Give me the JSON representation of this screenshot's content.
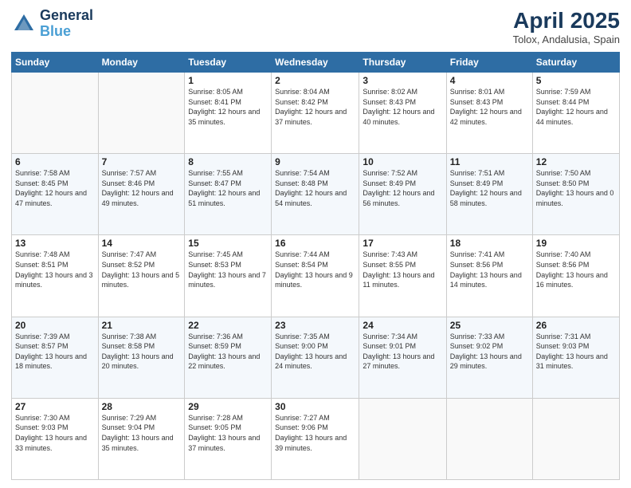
{
  "header": {
    "logo_line1": "General",
    "logo_line2": "Blue",
    "main_title": "April 2025",
    "subtitle": "Tolox, Andalusia, Spain"
  },
  "columns": [
    "Sunday",
    "Monday",
    "Tuesday",
    "Wednesday",
    "Thursday",
    "Friday",
    "Saturday"
  ],
  "weeks": [
    [
      {
        "day": "",
        "info": ""
      },
      {
        "day": "",
        "info": ""
      },
      {
        "day": "1",
        "info": "Sunrise: 8:05 AM\nSunset: 8:41 PM\nDaylight: 12 hours and 35 minutes."
      },
      {
        "day": "2",
        "info": "Sunrise: 8:04 AM\nSunset: 8:42 PM\nDaylight: 12 hours and 37 minutes."
      },
      {
        "day": "3",
        "info": "Sunrise: 8:02 AM\nSunset: 8:43 PM\nDaylight: 12 hours and 40 minutes."
      },
      {
        "day": "4",
        "info": "Sunrise: 8:01 AM\nSunset: 8:43 PM\nDaylight: 12 hours and 42 minutes."
      },
      {
        "day": "5",
        "info": "Sunrise: 7:59 AM\nSunset: 8:44 PM\nDaylight: 12 hours and 44 minutes."
      }
    ],
    [
      {
        "day": "6",
        "info": "Sunrise: 7:58 AM\nSunset: 8:45 PM\nDaylight: 12 hours and 47 minutes."
      },
      {
        "day": "7",
        "info": "Sunrise: 7:57 AM\nSunset: 8:46 PM\nDaylight: 12 hours and 49 minutes."
      },
      {
        "day": "8",
        "info": "Sunrise: 7:55 AM\nSunset: 8:47 PM\nDaylight: 12 hours and 51 minutes."
      },
      {
        "day": "9",
        "info": "Sunrise: 7:54 AM\nSunset: 8:48 PM\nDaylight: 12 hours and 54 minutes."
      },
      {
        "day": "10",
        "info": "Sunrise: 7:52 AM\nSunset: 8:49 PM\nDaylight: 12 hours and 56 minutes."
      },
      {
        "day": "11",
        "info": "Sunrise: 7:51 AM\nSunset: 8:49 PM\nDaylight: 12 hours and 58 minutes."
      },
      {
        "day": "12",
        "info": "Sunrise: 7:50 AM\nSunset: 8:50 PM\nDaylight: 13 hours and 0 minutes."
      }
    ],
    [
      {
        "day": "13",
        "info": "Sunrise: 7:48 AM\nSunset: 8:51 PM\nDaylight: 13 hours and 3 minutes."
      },
      {
        "day": "14",
        "info": "Sunrise: 7:47 AM\nSunset: 8:52 PM\nDaylight: 13 hours and 5 minutes."
      },
      {
        "day": "15",
        "info": "Sunrise: 7:45 AM\nSunset: 8:53 PM\nDaylight: 13 hours and 7 minutes."
      },
      {
        "day": "16",
        "info": "Sunrise: 7:44 AM\nSunset: 8:54 PM\nDaylight: 13 hours and 9 minutes."
      },
      {
        "day": "17",
        "info": "Sunrise: 7:43 AM\nSunset: 8:55 PM\nDaylight: 13 hours and 11 minutes."
      },
      {
        "day": "18",
        "info": "Sunrise: 7:41 AM\nSunset: 8:56 PM\nDaylight: 13 hours and 14 minutes."
      },
      {
        "day": "19",
        "info": "Sunrise: 7:40 AM\nSunset: 8:56 PM\nDaylight: 13 hours and 16 minutes."
      }
    ],
    [
      {
        "day": "20",
        "info": "Sunrise: 7:39 AM\nSunset: 8:57 PM\nDaylight: 13 hours and 18 minutes."
      },
      {
        "day": "21",
        "info": "Sunrise: 7:38 AM\nSunset: 8:58 PM\nDaylight: 13 hours and 20 minutes."
      },
      {
        "day": "22",
        "info": "Sunrise: 7:36 AM\nSunset: 8:59 PM\nDaylight: 13 hours and 22 minutes."
      },
      {
        "day": "23",
        "info": "Sunrise: 7:35 AM\nSunset: 9:00 PM\nDaylight: 13 hours and 24 minutes."
      },
      {
        "day": "24",
        "info": "Sunrise: 7:34 AM\nSunset: 9:01 PM\nDaylight: 13 hours and 27 minutes."
      },
      {
        "day": "25",
        "info": "Sunrise: 7:33 AM\nSunset: 9:02 PM\nDaylight: 13 hours and 29 minutes."
      },
      {
        "day": "26",
        "info": "Sunrise: 7:31 AM\nSunset: 9:03 PM\nDaylight: 13 hours and 31 minutes."
      }
    ],
    [
      {
        "day": "27",
        "info": "Sunrise: 7:30 AM\nSunset: 9:03 PM\nDaylight: 13 hours and 33 minutes."
      },
      {
        "day": "28",
        "info": "Sunrise: 7:29 AM\nSunset: 9:04 PM\nDaylight: 13 hours and 35 minutes."
      },
      {
        "day": "29",
        "info": "Sunrise: 7:28 AM\nSunset: 9:05 PM\nDaylight: 13 hours and 37 minutes."
      },
      {
        "day": "30",
        "info": "Sunrise: 7:27 AM\nSunset: 9:06 PM\nDaylight: 13 hours and 39 minutes."
      },
      {
        "day": "",
        "info": ""
      },
      {
        "day": "",
        "info": ""
      },
      {
        "day": "",
        "info": ""
      }
    ]
  ]
}
